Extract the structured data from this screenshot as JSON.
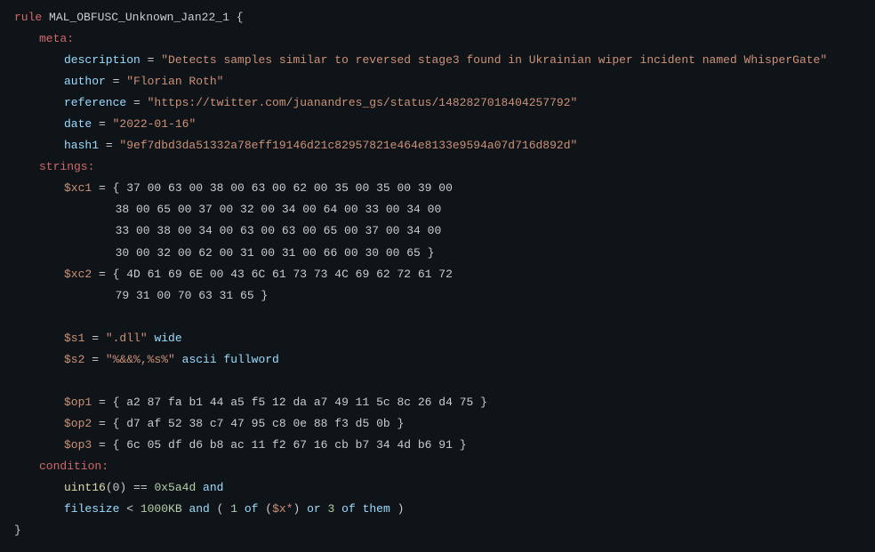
{
  "rule": {
    "keyword": "rule",
    "name": "MAL_OBFUSC_Unknown_Jan22_1",
    "open_brace": "{",
    "close_brace": "}"
  },
  "meta": {
    "keyword": "meta:",
    "description_key": "description",
    "description_val": "\"Detects samples similar to reversed stage3 found in Ukrainian wiper incident named WhisperGate\"",
    "author_key": "author",
    "author_val": "\"Florian Roth\"",
    "reference_key": "reference",
    "reference_val": "\"https://twitter.com/juanandres_gs/status/1482827018404257792\"",
    "date_key": "date",
    "date_val": "\"2022-01-16\"",
    "hash1_key": "hash1",
    "hash1_val": "\"9ef7dbd3da51332a78eff19146d21c82957821e464e8133e9594a07d716d892d\""
  },
  "strings": {
    "keyword": "strings:",
    "xc1_name": "$xc1",
    "xc1_l1": "{ 37 00 63 00 38 00 63 00 62 00 35 00 35 00 39 00",
    "xc1_l2": "  38 00 65 00 37 00 32 00 34 00 64 00 33 00 34 00",
    "xc1_l3": "  33 00 38 00 34 00 63 00 63 00 65 00 37 00 34 00",
    "xc1_l4": "  30 00 32 00 62 00 31 00 31 00 66 00 30 00 65 }",
    "xc2_name": "$xc2",
    "xc2_l1": "{ 4D 61 69 6E 00 43 6C 61 73 73 4C 69 62 72 61 72",
    "xc2_l2": "  79 31 00 70 63 31 65 }",
    "s1_name": "$s1",
    "s1_val": "\".dll\"",
    "s1_mod": "wide",
    "s2_name": "$s2",
    "s2_val": "\"%&&%,%s%\"",
    "s2_mod": "ascii fullword",
    "op1_name": "$op1",
    "op1_val": "{ a2 87 fa b1 44 a5 f5 12 da a7 49 11 5c 8c 26 d4 75 }",
    "op2_name": "$op2",
    "op2_val": "{ d7 af 52 38 c7 47 95 c8 0e 88 f3 d5 0b }",
    "op3_name": "$op3",
    "op3_val": "{ 6c 05 df d6 b8 ac 11 f2 67 16 cb b7 34 4d b6 91 }"
  },
  "condition": {
    "keyword": "condition:",
    "line1_func": "uint16",
    "line1_arg": "(0)",
    "line1_eq": " == ",
    "line1_val": "0x5a4d",
    "line1_and": " and",
    "line2_a": "filesize",
    "line2_lt": " < ",
    "line2_size": "1000KB",
    "line2_and": " and ",
    "line2_p1": "( ",
    "line2_one": "1",
    "line2_of1": " of ",
    "line2_p2": "(",
    "line2_xref": "$x*",
    "line2_p3": ")",
    "line2_or": " or ",
    "line2_three": "3",
    "line2_of2": " of them ",
    "line2_p4": ")"
  },
  "eq": " = "
}
